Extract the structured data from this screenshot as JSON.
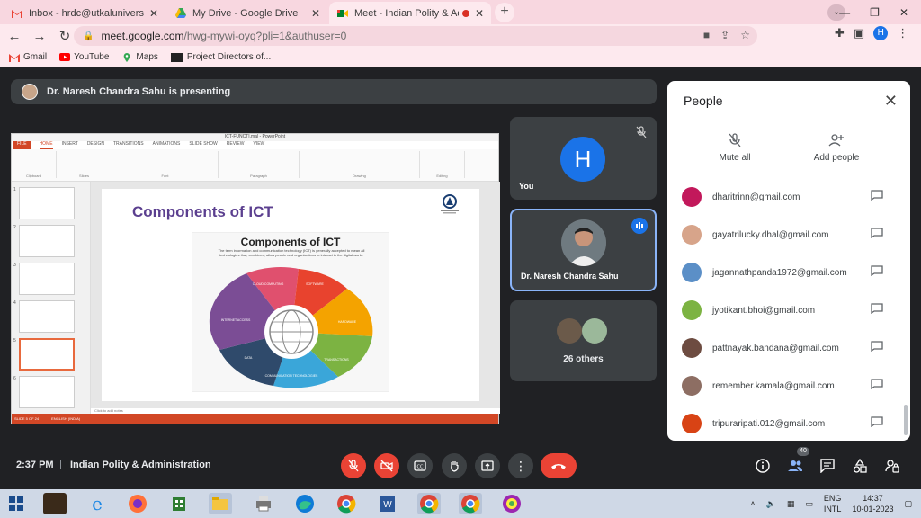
{
  "browser": {
    "tabs": [
      {
        "title": "Inbox - hrdc@utkaluniversity.ac.i",
        "icon": "gmail-icon"
      },
      {
        "title": "My Drive - Google Drive",
        "icon": "drive-icon"
      },
      {
        "title": "Meet - Indian Polity & Admi",
        "icon": "meet-icon",
        "active": true
      }
    ],
    "url_host": "meet.google.com",
    "url_path": "/hwg-mywi-oyq?pli=1&authuser=0",
    "profile_initial": "H",
    "bookmarks": [
      "Gmail",
      "YouTube",
      "Maps",
      "Project Directors of..."
    ]
  },
  "meet": {
    "presenting_text": "Dr. Naresh Chandra Sahu is presenting",
    "slide_heading": "Components of ICT",
    "slide_image_heading": "Components of ICT",
    "slide_image_desc": "The term information and communication technology (ICT) is generally accepted to mean all technologies that, combined, allow people and organizations to interact in the digital world.",
    "wheel_labels": [
      "CLOUD COMPUTING",
      "SOFTWARE",
      "HARDWARE",
      "TRANSACTIONS",
      "COMMUNICATION TECHNOLOGIES",
      "DATA",
      "INTERNET ACCESS"
    ],
    "ppt_window_title": "ICT-FUNCTI.mal - PowerPoint",
    "ppt_tabs": [
      "FILE",
      "HOME",
      "INSERT",
      "DESIGN",
      "TRANSITIONS",
      "ANIMATIONS",
      "SLIDE SHOW",
      "REVIEW",
      "VIEW"
    ],
    "ppt_groups": [
      "Clipboard",
      "Slides",
      "Font",
      "Paragraph",
      "Drawing",
      "Editing"
    ],
    "ppt_notes": "Click to add notes",
    "ppt_status": "SLIDE 5 OF 24",
    "ppt_lang": "ENGLISH (INDIA)",
    "tiles": {
      "you_label": "You",
      "you_initial": "H",
      "presenter_label": "Dr. Naresh Chandra Sahu",
      "others_label": "26 others"
    },
    "people_panel": {
      "title": "People",
      "mute_all": "Mute all",
      "add_people": "Add people",
      "participants": [
        {
          "email": "dharitrinn@gmail.com",
          "color": "#c2185b"
        },
        {
          "email": "gayatrilucky.dhal@gmail.com",
          "color": "#d7a48a"
        },
        {
          "email": "jagannathpanda1972@gmail.com",
          "color": "#5b8fc7"
        },
        {
          "email": "jyotikant.bhoi@gmail.com",
          "color": "#7cb342"
        },
        {
          "email": "pattnayak.bandana@gmail.com",
          "color": "#6d4c41"
        },
        {
          "email": "remember.kamala@gmail.com",
          "color": "#8d6e63"
        },
        {
          "email": "tripuraripati.012@gmail.com",
          "color": "#d84315"
        }
      ]
    },
    "bottom": {
      "time": "2:37 PM",
      "separator": "|",
      "meeting_name": "Indian Polity & Administration",
      "people_count": "40"
    }
  },
  "taskbar": {
    "lang_top": "ENG",
    "lang_bottom": "INTL",
    "time": "14:37",
    "date": "10-01-2023"
  },
  "colors": {
    "meet_bg": "#202124",
    "tile_bg": "#3c4043",
    "accent_blue": "#1a73e8",
    "danger_red": "#ea4335",
    "chrome_pink": "#fde9ee"
  }
}
